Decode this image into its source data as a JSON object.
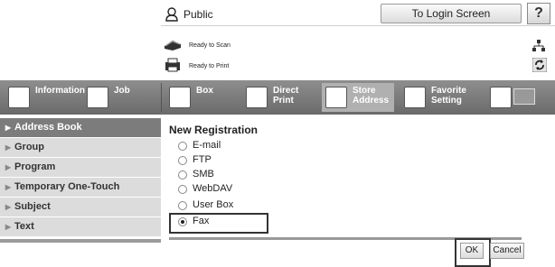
{
  "header": {
    "user_label": "Public",
    "login_button": "To Login Screen",
    "help_button": "?",
    "status": [
      "Ready to Scan",
      "Ready to Print"
    ]
  },
  "tabs": [
    {
      "label_line1": "Information",
      "label_line2": "",
      "icon": "information-icon"
    },
    {
      "label_line1": "Job",
      "label_line2": "",
      "icon": "job-icon"
    },
    {
      "label_line1": "Box",
      "label_line2": "",
      "icon": "box-icon"
    },
    {
      "label_line1": "Direct Print",
      "label_line2": "",
      "icon": "direct-print-icon"
    },
    {
      "label_line1": "Store",
      "label_line2": "Address",
      "icon": "store-address-icon",
      "active": true
    },
    {
      "label_line1": "Favorite",
      "label_line2": "Setting",
      "icon": "favorite-setting-icon"
    }
  ],
  "sidebar": {
    "items": [
      {
        "label": "Address Book",
        "active": true
      },
      {
        "label": "Group"
      },
      {
        "label": "Program"
      },
      {
        "label": "Temporary One-Touch"
      },
      {
        "label": "Subject"
      },
      {
        "label": "Text"
      }
    ]
  },
  "main": {
    "title": "New Registration",
    "options": [
      {
        "label": "E-mail",
        "selected": false
      },
      {
        "label": "FTP",
        "selected": false
      },
      {
        "label": "SMB",
        "selected": false
      },
      {
        "label": "WebDAV",
        "selected": false
      },
      {
        "label": "User Box",
        "selected": false
      },
      {
        "label": "Fax",
        "selected": true
      }
    ],
    "ok_button": "OK",
    "cancel_button": "Cancel"
  },
  "colors": {
    "tab_bar": "#7a7a7a",
    "sidebar_item": "#dcdcdc",
    "sidebar_active": "#7c7c7c"
  }
}
